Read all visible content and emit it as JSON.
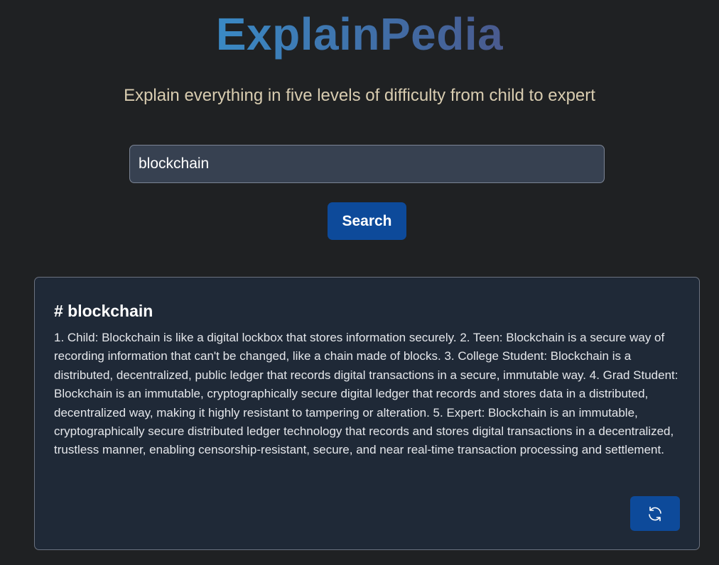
{
  "header": {
    "logo_text": "ExplainPedia",
    "subtitle": "Explain everything in five levels of difficulty from child to expert"
  },
  "search": {
    "value": "blockchain",
    "button_label": "Search"
  },
  "result": {
    "title": "# blockchain",
    "body": "1. Child: Blockchain is like a digital lockbox that stores information securely. 2. Teen: Blockchain is a secure way of recording information that can't be changed, like a chain made of blocks. 3. College Student: Blockchain is a distributed, decentralized, public ledger that records digital transactions in a secure, immutable way. 4. Grad Student: Blockchain is an immutable, cryptographically secure digital ledger that records and stores data in a distributed, decentralized way, making it highly resistant to tampering or alteration. 5. Expert: Blockchain is an immutable, cryptographically secure distributed ledger technology that records and stores digital transactions in a decentralized, trustless manner, enabling censorship-resistant, secure, and near real-time transaction processing and settlement.",
    "refresh_icon": "refresh-icon"
  },
  "colors": {
    "background": "#1f2123",
    "accent": "#0d4a9a",
    "card_background": "#1f2937",
    "input_background": "#374151",
    "subtitle": "#d8ccb0"
  }
}
